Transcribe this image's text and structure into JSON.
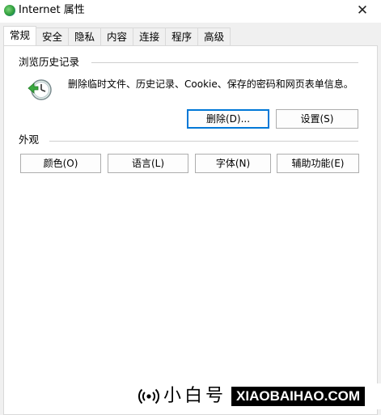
{
  "window": {
    "title": "Internet 属性",
    "close_glyph": "✕"
  },
  "tabs": [
    {
      "label": "常规",
      "active": true
    },
    {
      "label": "安全",
      "active": false
    },
    {
      "label": "隐私",
      "active": false
    },
    {
      "label": "内容",
      "active": false
    },
    {
      "label": "连接",
      "active": false
    },
    {
      "label": "程序",
      "active": false
    },
    {
      "label": "高级",
      "active": false
    }
  ],
  "history": {
    "section_title": "浏览历史记录",
    "icon": "history-clock-icon",
    "description": "删除临时文件、历史记录、Cookie、保存的密码和网页表单信息。",
    "delete_button": "删除(D)...",
    "settings_button": "设置(S)"
  },
  "appearance": {
    "section_title": "外观",
    "buttons": {
      "colors": "颜色(O)",
      "languages": "语言(L)",
      "fonts": "字体(N)",
      "accessibility": "辅助功能(E)"
    }
  },
  "watermark": {
    "cn_text": "小白号",
    "en_text": "XIAOBAIHAO.COM"
  },
  "colors": {
    "accent": "#0078d7",
    "window_bg": "#f0f0f0",
    "panel_bg": "#ffffff"
  }
}
